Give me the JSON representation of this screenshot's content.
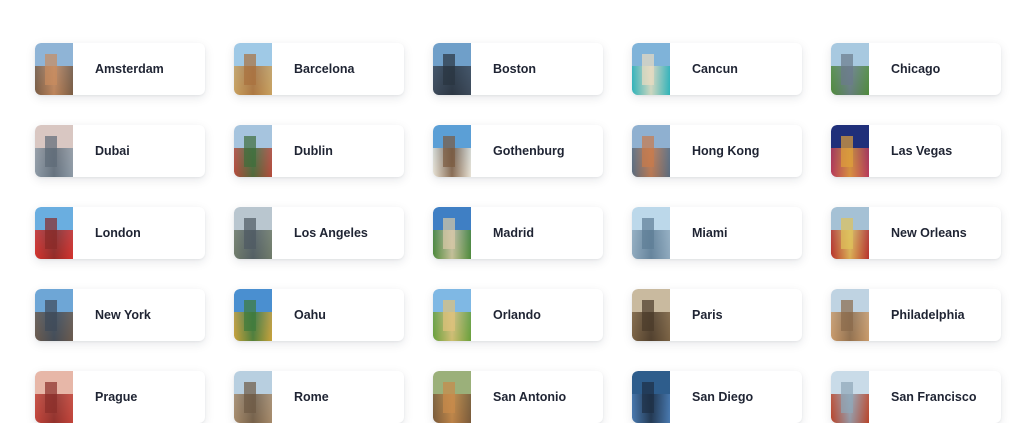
{
  "destinations": [
    {
      "name": "Amsterdam",
      "sky": "#8fb4d6",
      "land": "#7a5c44",
      "accent": "#c98b5e"
    },
    {
      "name": "Barcelona",
      "sky": "#9fc9e6",
      "land": "#c9a15f",
      "accent": "#a9713d"
    },
    {
      "name": "Boston",
      "sky": "#6f9fc9",
      "land": "#3d4a5a",
      "accent": "#2a3440"
    },
    {
      "name": "Cancun",
      "sky": "#7fb3d9",
      "land": "#2fb3b8",
      "accent": "#e9dcc0"
    },
    {
      "name": "Chicago",
      "sky": "#a8c9e0",
      "land": "#4f8a3c",
      "accent": "#6b7b8a"
    },
    {
      "name": "Dubai",
      "sky": "#d9c7c2",
      "land": "#8d9aa6",
      "accent": "#5e6b78"
    },
    {
      "name": "Dublin",
      "sky": "#a6c4de",
      "land": "#b54a3a",
      "accent": "#3f6e3a"
    },
    {
      "name": "Gothenburg",
      "sky": "#5b9fd6",
      "land": "#e8e2d4",
      "accent": "#7b5a3f"
    },
    {
      "name": "Hong Kong",
      "sky": "#8fb0d0",
      "land": "#5a6b7d",
      "accent": "#c97a4a"
    },
    {
      "name": "Las Vegas",
      "sky": "#1f2f7a",
      "land": "#b83a5a",
      "accent": "#e0a03a"
    },
    {
      "name": "London",
      "sky": "#6aaee0",
      "land": "#d4322c",
      "accent": "#8a2a26"
    },
    {
      "name": "Los Angeles",
      "sky": "#b9c6cf",
      "land": "#6f7b6a",
      "accent": "#4e5a62"
    },
    {
      "name": "Madrid",
      "sky": "#3f7fc4",
      "land": "#4f8a3a",
      "accent": "#d9c9a6"
    },
    {
      "name": "Miami",
      "sky": "#bcd8ea",
      "land": "#8fa9bd",
      "accent": "#5e7d96"
    },
    {
      "name": "New Orleans",
      "sky": "#a5c1d5",
      "land": "#b8322a",
      "accent": "#e0c25a"
    },
    {
      "name": "New York",
      "sky": "#6ea6d6",
      "land": "#6b5a4d",
      "accent": "#3e4a58"
    },
    {
      "name": "Oahu",
      "sky": "#4a8fd0",
      "land": "#c9a23a",
      "accent": "#3f7a3a"
    },
    {
      "name": "Orlando",
      "sky": "#7fb8e4",
      "land": "#6aa03a",
      "accent": "#e0c27a"
    },
    {
      "name": "Paris",
      "sky": "#c9ba9f",
      "land": "#7a6244",
      "accent": "#4a3a2a"
    },
    {
      "name": "Philadelphia",
      "sky": "#bfd3e2",
      "land": "#c99a6a",
      "accent": "#8a6a4a"
    },
    {
      "name": "Prague",
      "sky": "#e7b7a8",
      "land": "#c2443a",
      "accent": "#8a2e2a"
    },
    {
      "name": "Rome",
      "sky": "#b8cfe0",
      "land": "#a68a6a",
      "accent": "#6e5a44"
    },
    {
      "name": "San Antonio",
      "sky": "#9bb07a",
      "land": "#7a5a3a",
      "accent": "#c98a4a"
    },
    {
      "name": "San Diego",
      "sky": "#2e5d8c",
      "land": "#4a7ab0",
      "accent": "#1e2f44"
    },
    {
      "name": "San Francisco",
      "sky": "#c9dbe8",
      "land": "#b8442a",
      "accent": "#8fa6b8"
    }
  ]
}
